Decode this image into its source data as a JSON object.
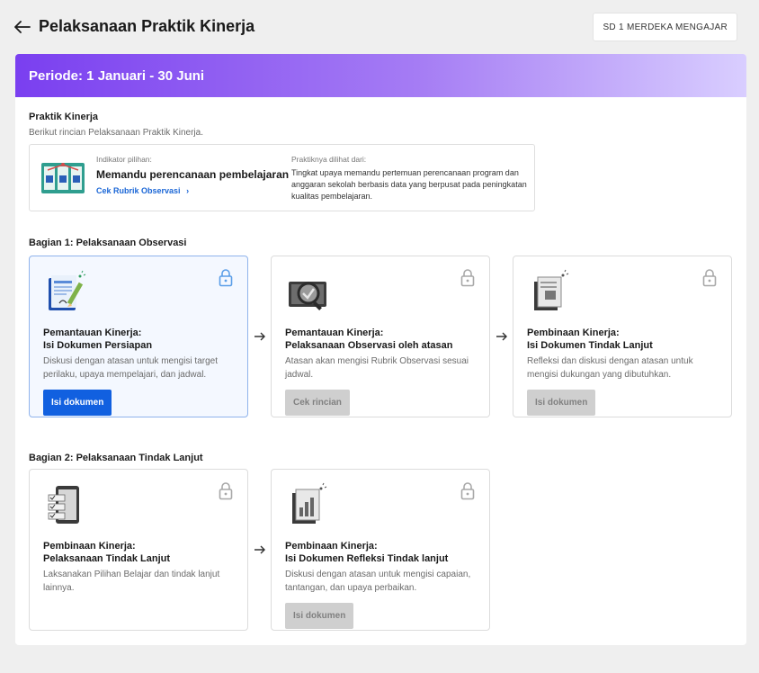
{
  "header": {
    "title": "Pelaksanaan Praktik Kinerja",
    "school_label": "SD 1 MERDEKA MENGAJAR"
  },
  "periode": {
    "label": "Periode: 1 Januari - 30 Juni"
  },
  "praktik": {
    "title": "Praktik Kinerja",
    "subtitle": "Berikut rincian Pelaksanaan Praktik Kinerja.",
    "indikator_label": "Indikator pilihan:",
    "indikator_title": "Memandu perencanaan pembelajaran",
    "indikator_link": "Cek Rubrik Observasi",
    "dilihat_label": "Praktiknya dilihat dari:",
    "dilihat_text": "Tingkat upaya memandu pertemuan perencanaan program dan anggaran sekolah berbasis data yang berpusat pada peningkatan kualitas pembelajaran."
  },
  "bagian1": {
    "title": "Bagian 1: Pelaksanaan Observasi",
    "steps": [
      {
        "title_line1": "Pemantauan Kinerja:",
        "title_line2": "Isi Dokumen Persiapan",
        "desc": "Diskusi dengan atasan untuk mengisi target perilaku, upaya mempelajari, dan jadwal.",
        "button": "Isi dokumen"
      },
      {
        "title_line1": "Pemantauan Kinerja:",
        "title_line2": "Pelaksanaan Observasi oleh atasan",
        "desc": "Atasan akan mengisi Rubrik Observasi sesuai jadwal.",
        "button": "Cek rincian"
      },
      {
        "title_line1": "Pembinaan Kinerja:",
        "title_line2": "Isi Dokumen Tindak Lanjut",
        "desc": "Refleksi dan diskusi dengan atasan untuk mengisi dukungan yang dibutuhkan.",
        "button": "Isi dokumen"
      }
    ]
  },
  "bagian2": {
    "title": "Bagian 2: Pelaksanaan Tindak Lanjut",
    "steps": [
      {
        "title_line1": "Pembinaan Kinerja:",
        "title_line2": "Pelaksanaan Tindak Lanjut",
        "desc": "Laksanakan Pilihan Belajar dan tindak lanjut lainnya."
      },
      {
        "title_line1": "Pembinaan Kinerja:",
        "title_line2": "Isi Dokumen Refleksi Tindak lanjut",
        "desc": "Diskusi dengan atasan untuk mengisi capaian, tantangan, dan upaya perbaikan.",
        "button": "Isi dokumen"
      }
    ]
  },
  "colors": {
    "primary": "#1160e0",
    "accent_purple": "#7a3ff0",
    "link": "#1a66d6"
  }
}
